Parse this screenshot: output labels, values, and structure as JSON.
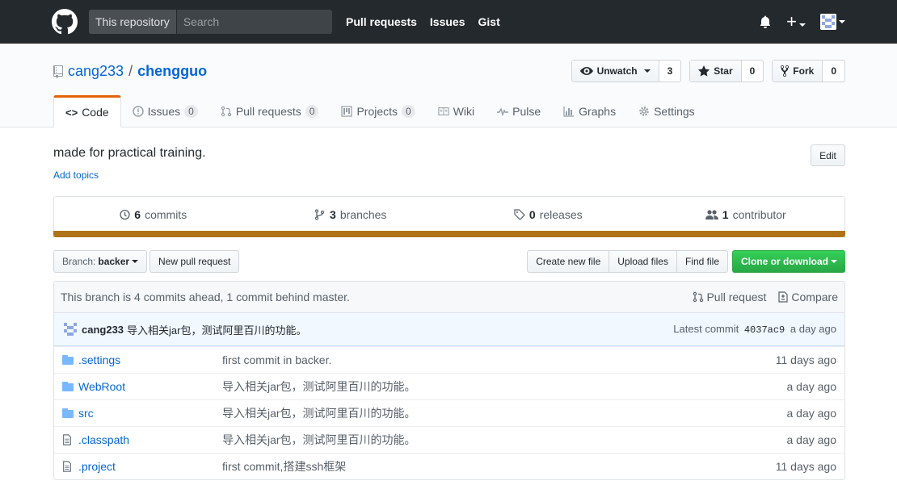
{
  "header": {
    "scope_label": "This repository",
    "search_placeholder": "Search",
    "nav": [
      "Pull requests",
      "Issues",
      "Gist"
    ]
  },
  "repo": {
    "owner": "cang233",
    "separator": "/",
    "name": "chengguo",
    "watch_label": "Unwatch",
    "watch_count": "3",
    "star_label": "Star",
    "star_count": "0",
    "fork_label": "Fork",
    "fork_count": "0"
  },
  "tabs": [
    {
      "label": "Code",
      "counter": null,
      "icon": "code-icon"
    },
    {
      "label": "Issues",
      "counter": "0",
      "icon": "issue-icon"
    },
    {
      "label": "Pull requests",
      "counter": "0",
      "icon": "pull-request-icon"
    },
    {
      "label": "Projects",
      "counter": "0",
      "icon": "project-icon"
    },
    {
      "label": "Wiki",
      "counter": null,
      "icon": "wiki-icon"
    },
    {
      "label": "Pulse",
      "counter": null,
      "icon": "pulse-icon"
    },
    {
      "label": "Graphs",
      "counter": null,
      "icon": "graph-icon"
    },
    {
      "label": "Settings",
      "counter": null,
      "icon": "gear-icon"
    }
  ],
  "description": "made for practical training.",
  "add_topics": "Add topics",
  "edit_label": "Edit",
  "summary": {
    "commits_num": "6",
    "commits_label": "commits",
    "branches_num": "3",
    "branches_label": "branches",
    "releases_num": "0",
    "releases_label": "releases",
    "contributors_num": "1",
    "contributors_label": "contributor"
  },
  "language_color": "#b07219",
  "file_nav": {
    "branch_prefix": "Branch:",
    "branch_name": "backer",
    "new_pr": "New pull request",
    "create_file": "Create new file",
    "upload_files": "Upload files",
    "find_file": "Find file",
    "clone": "Clone or download"
  },
  "branch_info": {
    "text": "This branch is 4 commits ahead, 1 commit behind master.",
    "pull_request": "Pull request",
    "compare": "Compare"
  },
  "latest_commit": {
    "author": "cang233",
    "message": "导入相关jar包，测试阿里百川的功能。",
    "prefix": "Latest commit",
    "sha": "4037ac9",
    "age": "a day ago"
  },
  "files": [
    {
      "type": "dir",
      "name": ".settings",
      "message": "first commit in backer.",
      "age": "11 days ago"
    },
    {
      "type": "dir",
      "name": "WebRoot",
      "message": "导入相关jar包，测试阿里百川的功能。",
      "age": "a day ago"
    },
    {
      "type": "dir",
      "name": "src",
      "message": "导入相关jar包，测试阿里百川的功能。",
      "age": "a day ago"
    },
    {
      "type": "file",
      "name": ".classpath",
      "message": "导入相关jar包，测试阿里百川的功能。",
      "age": "a day ago"
    },
    {
      "type": "file",
      "name": ".project",
      "message": "first commit,搭建ssh框架",
      "age": "11 days ago"
    }
  ]
}
